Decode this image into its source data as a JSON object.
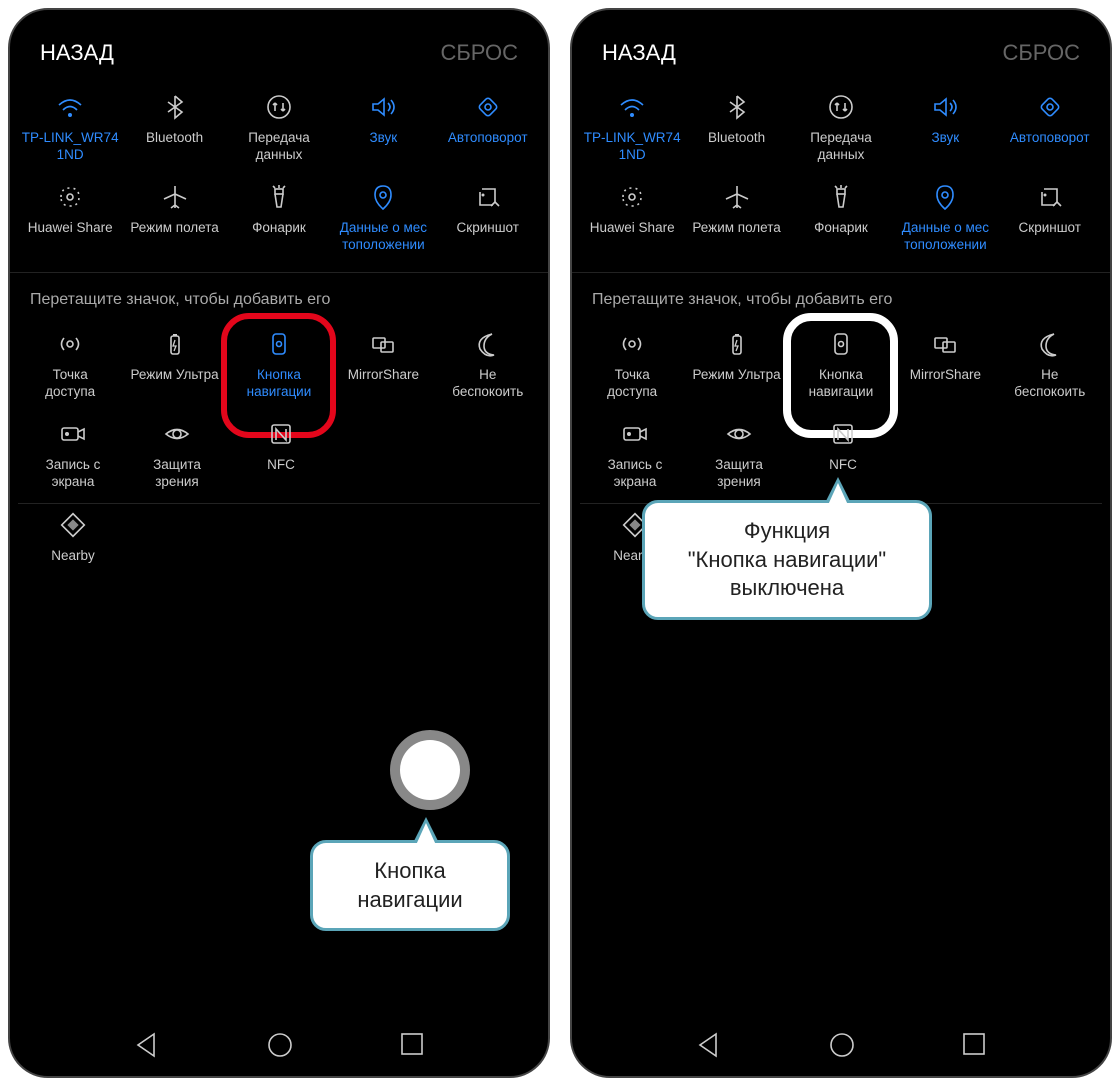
{
  "header": {
    "back": "НАЗАД",
    "reset": "СБРОС"
  },
  "section_label": "Перетащите значок, чтобы добавить его",
  "tiles_top": [
    {
      "id": "wifi",
      "label": "TP-LINK_WR74\n1ND",
      "active": true,
      "icon": "wifi"
    },
    {
      "id": "bluetooth",
      "label": "Bluetooth",
      "active": false,
      "icon": "bluetooth"
    },
    {
      "id": "data",
      "label": "Передача\nданных",
      "active": false,
      "icon": "data"
    },
    {
      "id": "sound",
      "label": "Звук",
      "active": true,
      "icon": "sound"
    },
    {
      "id": "rotate",
      "label": "Автоповорот",
      "active": true,
      "icon": "rotate"
    }
  ],
  "tiles_top2": [
    {
      "id": "huaweishare",
      "label": "Huawei Share",
      "active": false,
      "icon": "share"
    },
    {
      "id": "airplane",
      "label": "Режим полета",
      "active": false,
      "icon": "airplane"
    },
    {
      "id": "torch",
      "label": "Фонарик",
      "active": false,
      "icon": "torch"
    },
    {
      "id": "location",
      "label": "Данные о мес\nтоположении",
      "active": true,
      "icon": "location"
    },
    {
      "id": "screenshot",
      "label": "Скриншот",
      "active": false,
      "icon": "screenshot"
    }
  ],
  "tiles_drag1": [
    {
      "id": "hotspot",
      "label": "Точка\nдоступа",
      "icon": "hotspot"
    },
    {
      "id": "ultra",
      "label": "Режим Ультра",
      "icon": "battery"
    },
    {
      "id": "navbtn",
      "label": "Кнопка\nнавигации",
      "icon": "navbtn"
    },
    {
      "id": "mirror",
      "label": "MirrorShare",
      "icon": "mirror"
    },
    {
      "id": "dnd",
      "label": "Не\nбеспокоить",
      "icon": "moon"
    }
  ],
  "tiles_drag2": [
    {
      "id": "record",
      "label": "Запись с\nэкрана",
      "icon": "record"
    },
    {
      "id": "eyecare",
      "label": "Защита\nзрения",
      "icon": "eye"
    },
    {
      "id": "nfc",
      "label": "NFC",
      "icon": "nfc"
    }
  ],
  "tiles_drag3": [
    {
      "id": "nearby",
      "label": "Nearby",
      "icon": "nearby"
    }
  ],
  "left": {
    "navbtn_active": true,
    "callout": "Кнопка\nнавигации"
  },
  "right": {
    "navbtn_active": false,
    "callout": "Функция\n\"Кнопка навигации\"\nвыключена"
  }
}
